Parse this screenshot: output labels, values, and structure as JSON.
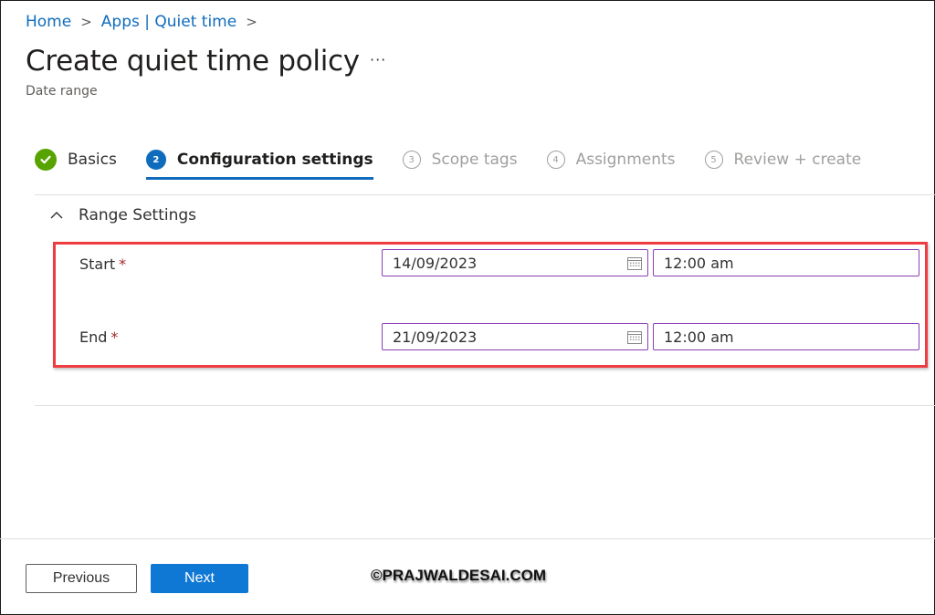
{
  "breadcrumb": {
    "items": [
      "Home",
      "Apps | Quiet time"
    ]
  },
  "header": {
    "title": "Create quiet time policy",
    "more_label": "···",
    "subtitle": "Date range"
  },
  "wizard": {
    "steps": [
      {
        "number": "✓",
        "label": "Basics",
        "state": "done"
      },
      {
        "number": "2",
        "label": "Configuration settings",
        "state": "active"
      },
      {
        "number": "3",
        "label": "Scope tags",
        "state": "pending"
      },
      {
        "number": "4",
        "label": "Assignments",
        "state": "pending"
      },
      {
        "number": "5",
        "label": "Review + create",
        "state": "pending"
      }
    ]
  },
  "section": {
    "title": "Range Settings",
    "expanded": true,
    "fields": [
      {
        "label": "Start",
        "required_mark": "*",
        "date": "14/09/2023",
        "time": "12:00 am"
      },
      {
        "label": "End",
        "required_mark": "*",
        "date": "21/09/2023",
        "time": "12:00 am"
      }
    ]
  },
  "footer": {
    "previous_label": "Previous",
    "next_label": "Next"
  },
  "watermark": "©PRAJWALDESAI.COM",
  "colors": {
    "accent": "#0f6cbd",
    "success": "#57a300",
    "highlight": "#ef3b42",
    "input_border": "#8a3fb8",
    "required": "#a4262c"
  }
}
